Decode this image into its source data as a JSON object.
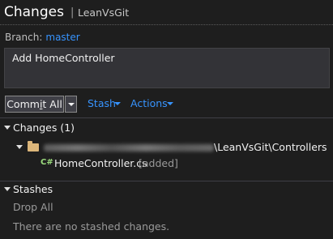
{
  "header": {
    "title": "Changes",
    "separator": "|",
    "repo": "LeanVsGit"
  },
  "branch": {
    "label": "Branch:",
    "value": "master"
  },
  "commit_message": {
    "value": "Add HomeController"
  },
  "actions": {
    "commit_pre": "Comm",
    "commit_u": "i",
    "commit_post": "t All",
    "stash_label": "Stash",
    "actions_label": "Actions"
  },
  "changes": {
    "header": "Changes (1)",
    "folder_path_suffix": "\\LeanVsGit\\Controllers",
    "file_icon": "C#",
    "file_name": "HomeController.cs",
    "file_status": "[added]"
  },
  "stashes": {
    "header": "Stashes",
    "drop_all_label": "Drop All",
    "empty_message": "There are no stashed changes."
  },
  "colors": {
    "background": "#1e1e1e",
    "link": "#3794ff",
    "button": "#3f3f46",
    "text_box": "#333337",
    "folder": "#dcb67a",
    "cs_icon": "#9cdc7e"
  }
}
